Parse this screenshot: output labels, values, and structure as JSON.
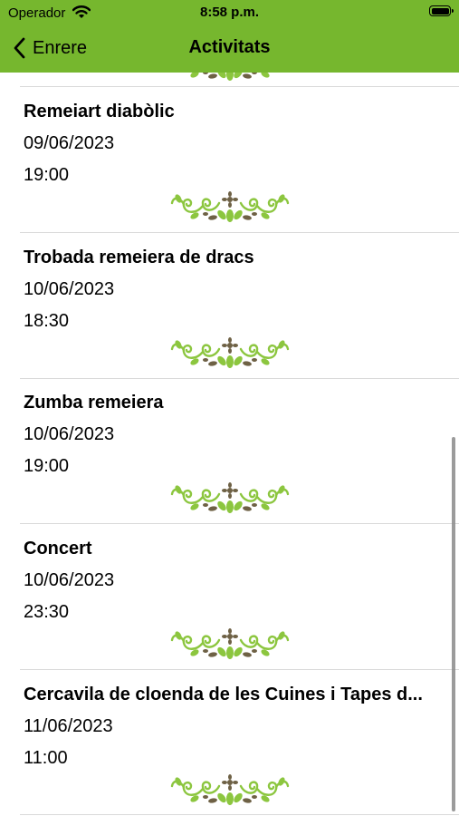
{
  "status_bar": {
    "carrier": "Operador",
    "time": "8:58 p.m."
  },
  "nav": {
    "back_label": "Enrere",
    "title": "Activitats"
  },
  "activities": [
    {
      "title": "Remeiart diabòlic",
      "date": "09/06/2023",
      "time": "19:00"
    },
    {
      "title": "Trobada remeiera de dracs",
      "date": "10/06/2023",
      "time": "18:30"
    },
    {
      "title": "Zumba remeiera",
      "date": "10/06/2023",
      "time": "19:00"
    },
    {
      "title": "Concert",
      "date": "10/06/2023",
      "time": "23:30"
    },
    {
      "title": "Cercavila de cloenda de les Cuines i Tapes d...",
      "date": "11/06/2023",
      "time": "11:00"
    }
  ],
  "colors": {
    "accent": "#76b72e",
    "ornament_leaf": "#8cc63f",
    "ornament_dark": "#6e6145"
  }
}
